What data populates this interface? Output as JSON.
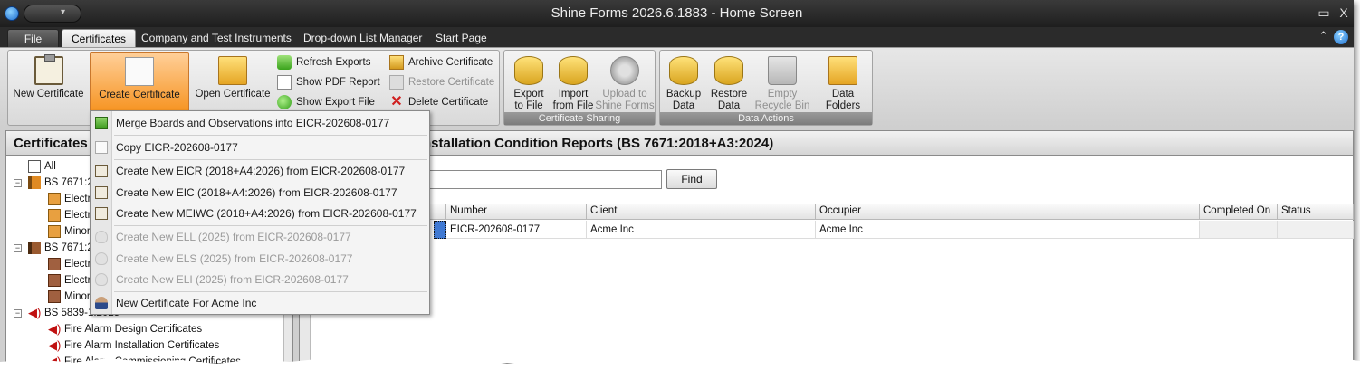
{
  "window": {
    "title": "Shine Forms 2026.6.1883 - Home Screen"
  },
  "window_controls": {
    "minimize": "–",
    "maximize": "▭",
    "close": "X"
  },
  "tabs": [
    "File",
    "Certificates",
    "Company and Test Instruments",
    "Drop-down List Manager",
    "Start Page"
  ],
  "ribbon": {
    "new_certificate": "New Certificate",
    "create_certificate": "Create Certificate",
    "open_certificate": "Open Certificate",
    "refresh_exports": "Refresh Exports",
    "show_pdf_report": "Show PDF Report",
    "show_export_file": "Show Export File",
    "archive_certificate": "Archive Certificate",
    "restore_certificate": "Restore Certificate",
    "delete_certificate": "Delete Certificate",
    "export_to_file": [
      "Export",
      "to File"
    ],
    "import_from_file": [
      "Import",
      "from File"
    ],
    "upload_to_shine_forms": [
      "Upload to",
      "Shine Forms"
    ],
    "group_certificate_sharing": "Certificate Sharing",
    "backup_data": [
      "Backup",
      "Data"
    ],
    "restore_data": [
      "Restore",
      "Data"
    ],
    "empty_recycle_bin": [
      "Empty",
      "Recycle Bin"
    ],
    "data_folders": "Data Folders",
    "group_data_actions": "Data Actions"
  },
  "menu": {
    "items": [
      {
        "label": "Merge Boards and Observations into EICR-202608-0177",
        "enabled": true
      },
      {
        "label": "Copy EICR-202608-0177",
        "enabled": true
      },
      {
        "label": "Create New EICR (2018+A4:2026) from EICR-202608-0177",
        "enabled": true
      },
      {
        "label": "Create New EIC (2018+A4:2026) from EICR-202608-0177",
        "enabled": true
      },
      {
        "label": "Create New MEIWC (2018+A4:2026) from EICR-202608-0177",
        "enabled": true
      },
      {
        "label": "Create New ELL (2025) from EICR-202608-0177",
        "enabled": false
      },
      {
        "label": "Create New ELS (2025) from EICR-202608-0177",
        "enabled": false
      },
      {
        "label": "Create New ELI (2025) from EICR-202608-0177",
        "enabled": false
      },
      {
        "label": "New Certificate For Acme Inc",
        "enabled": true
      }
    ]
  },
  "left_pane": {
    "title": "Certificates",
    "tree": [
      "All",
      "BS 7671:2",
      "Electri",
      "Electri",
      "Minor",
      "BS 7671:2",
      "Electri",
      "Electri",
      "Minor",
      "BS 5839-1:2025",
      "Fire Alarm Design Certificates",
      "Fire Alarm Installation Certificates",
      "Fire Alarm Commissioning Certificates"
    ]
  },
  "right_pane": {
    "title": "nstallation Condition Reports (BS 7671:2018+A3:2024)",
    "search_value": "",
    "find_label": "Find",
    "columns": [
      "",
      "Number",
      "Client",
      "Occupier",
      "Completed On",
      "Status"
    ],
    "rows": [
      {
        "number": "EICR-202608-0177",
        "client": "Acme Inc",
        "occupier": "Acme Inc",
        "completed_on": "",
        "status": ""
      }
    ]
  },
  "colors": {
    "accent": "#f6921e",
    "selection": "#3f79d3",
    "titlebar": "#1e1e1e"
  },
  "icons": [
    "app-logo-icon",
    "help-icon",
    "collapse-ribbon-icon",
    "clipboard-icon",
    "documents-icon",
    "folder-icon",
    "refresh-icon",
    "pdf-icon",
    "export-file-icon",
    "archive-icon",
    "restore-icon",
    "delete-icon",
    "database-export-icon",
    "database-import-icon",
    "upload-icon",
    "backup-icon",
    "restore-data-icon",
    "recycle-bin-icon",
    "data-folders-icon",
    "merge-icon",
    "copy-icon",
    "new-certificate-icon",
    "bulb-icon",
    "person-icon",
    "fire-alarm-icon"
  ]
}
